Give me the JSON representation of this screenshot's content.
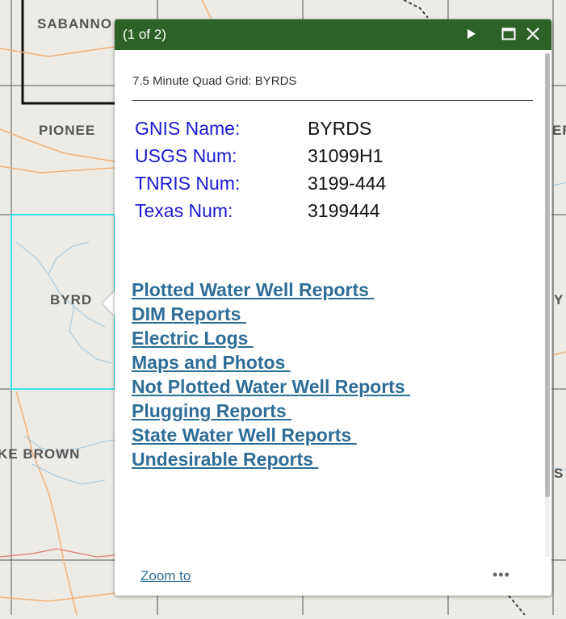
{
  "map": {
    "labels": {
      "sabanno": "SABANNO",
      "pionee": "PIONEE",
      "byrd": "BYRD",
      "ke_brown": "KE BROWN",
      "er": "ER",
      "y": "Y",
      "s_c": "S C"
    },
    "highlight_color": "#33e5e5"
  },
  "popup": {
    "count": "(1 of 2)",
    "header_color": "#2d6226",
    "title": "7.5 Minute Quad Grid: BYRDS",
    "attributes": [
      {
        "key": "GNIS Name:",
        "value": "BYRDS"
      },
      {
        "key": "USGS Num:",
        "value": "31099H1"
      },
      {
        "key": "TNRIS Num:",
        "value": "3199-444"
      },
      {
        "key": "Texas Num:",
        "value": "3199444"
      }
    ],
    "links": [
      "Plotted Water Well Reports ",
      "DIM Reports ",
      "Electric Logs ",
      "Maps and Photos ",
      "Not Plotted Water Well Reports ",
      "Plugging Reports ",
      "State Water Well Reports ",
      "Undesirable Reports "
    ],
    "footer": {
      "zoom_label": "Zoom to",
      "more_label": "•••"
    },
    "icons": {
      "next": "play-triangle-icon",
      "maximize": "maximize-icon",
      "close": "close-icon"
    }
  }
}
